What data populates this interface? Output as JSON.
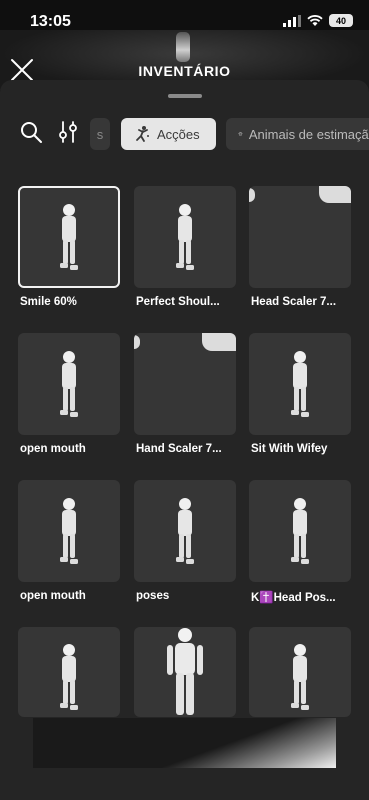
{
  "status_bar": {
    "time": "13:05",
    "battery": "40"
  },
  "header": {
    "title": "INVENTÁRIO"
  },
  "filters": {
    "cut_chip_label": "s",
    "chips": [
      {
        "label": "Acções",
        "selected": true,
        "icon": "figure-pose-icon"
      },
      {
        "label": "Animais de estimação",
        "selected": false,
        "icon": "paw-icon"
      }
    ]
  },
  "items": [
    {
      "label": "Smile 60%",
      "selected": true,
      "thumb": "figure-icon"
    },
    {
      "label": "Perfect Shoul...",
      "selected": false,
      "thumb": "figure-icon"
    },
    {
      "label": "Head Scaler 7...",
      "selected": false,
      "thumb": "scaler-icon"
    },
    {
      "label": "open mouth",
      "selected": false,
      "thumb": "figure-icon"
    },
    {
      "label": "Hand Scaler 7...",
      "selected": false,
      "thumb": "scaler-icon"
    },
    {
      "label": "Sit With Wifey",
      "selected": false,
      "thumb": "figure-icon"
    },
    {
      "label": "open mouth",
      "selected": false,
      "thumb": "figure-icon"
    },
    {
      "label": "poses",
      "selected": false,
      "thumb": "figure-icon"
    },
    {
      "label": "K✝️Head Pos...",
      "selected": false,
      "thumb": "figure-icon"
    },
    {
      "label": "",
      "selected": false,
      "thumb": "figure-icon"
    },
    {
      "label": "",
      "selected": false,
      "thumb": "large-figure-icon"
    },
    {
      "label": "",
      "selected": false,
      "thumb": "figure-icon"
    }
  ],
  "colors": {
    "sheet": "#252525",
    "tile": "#363636",
    "selected_chip": "#e6e6e6"
  }
}
